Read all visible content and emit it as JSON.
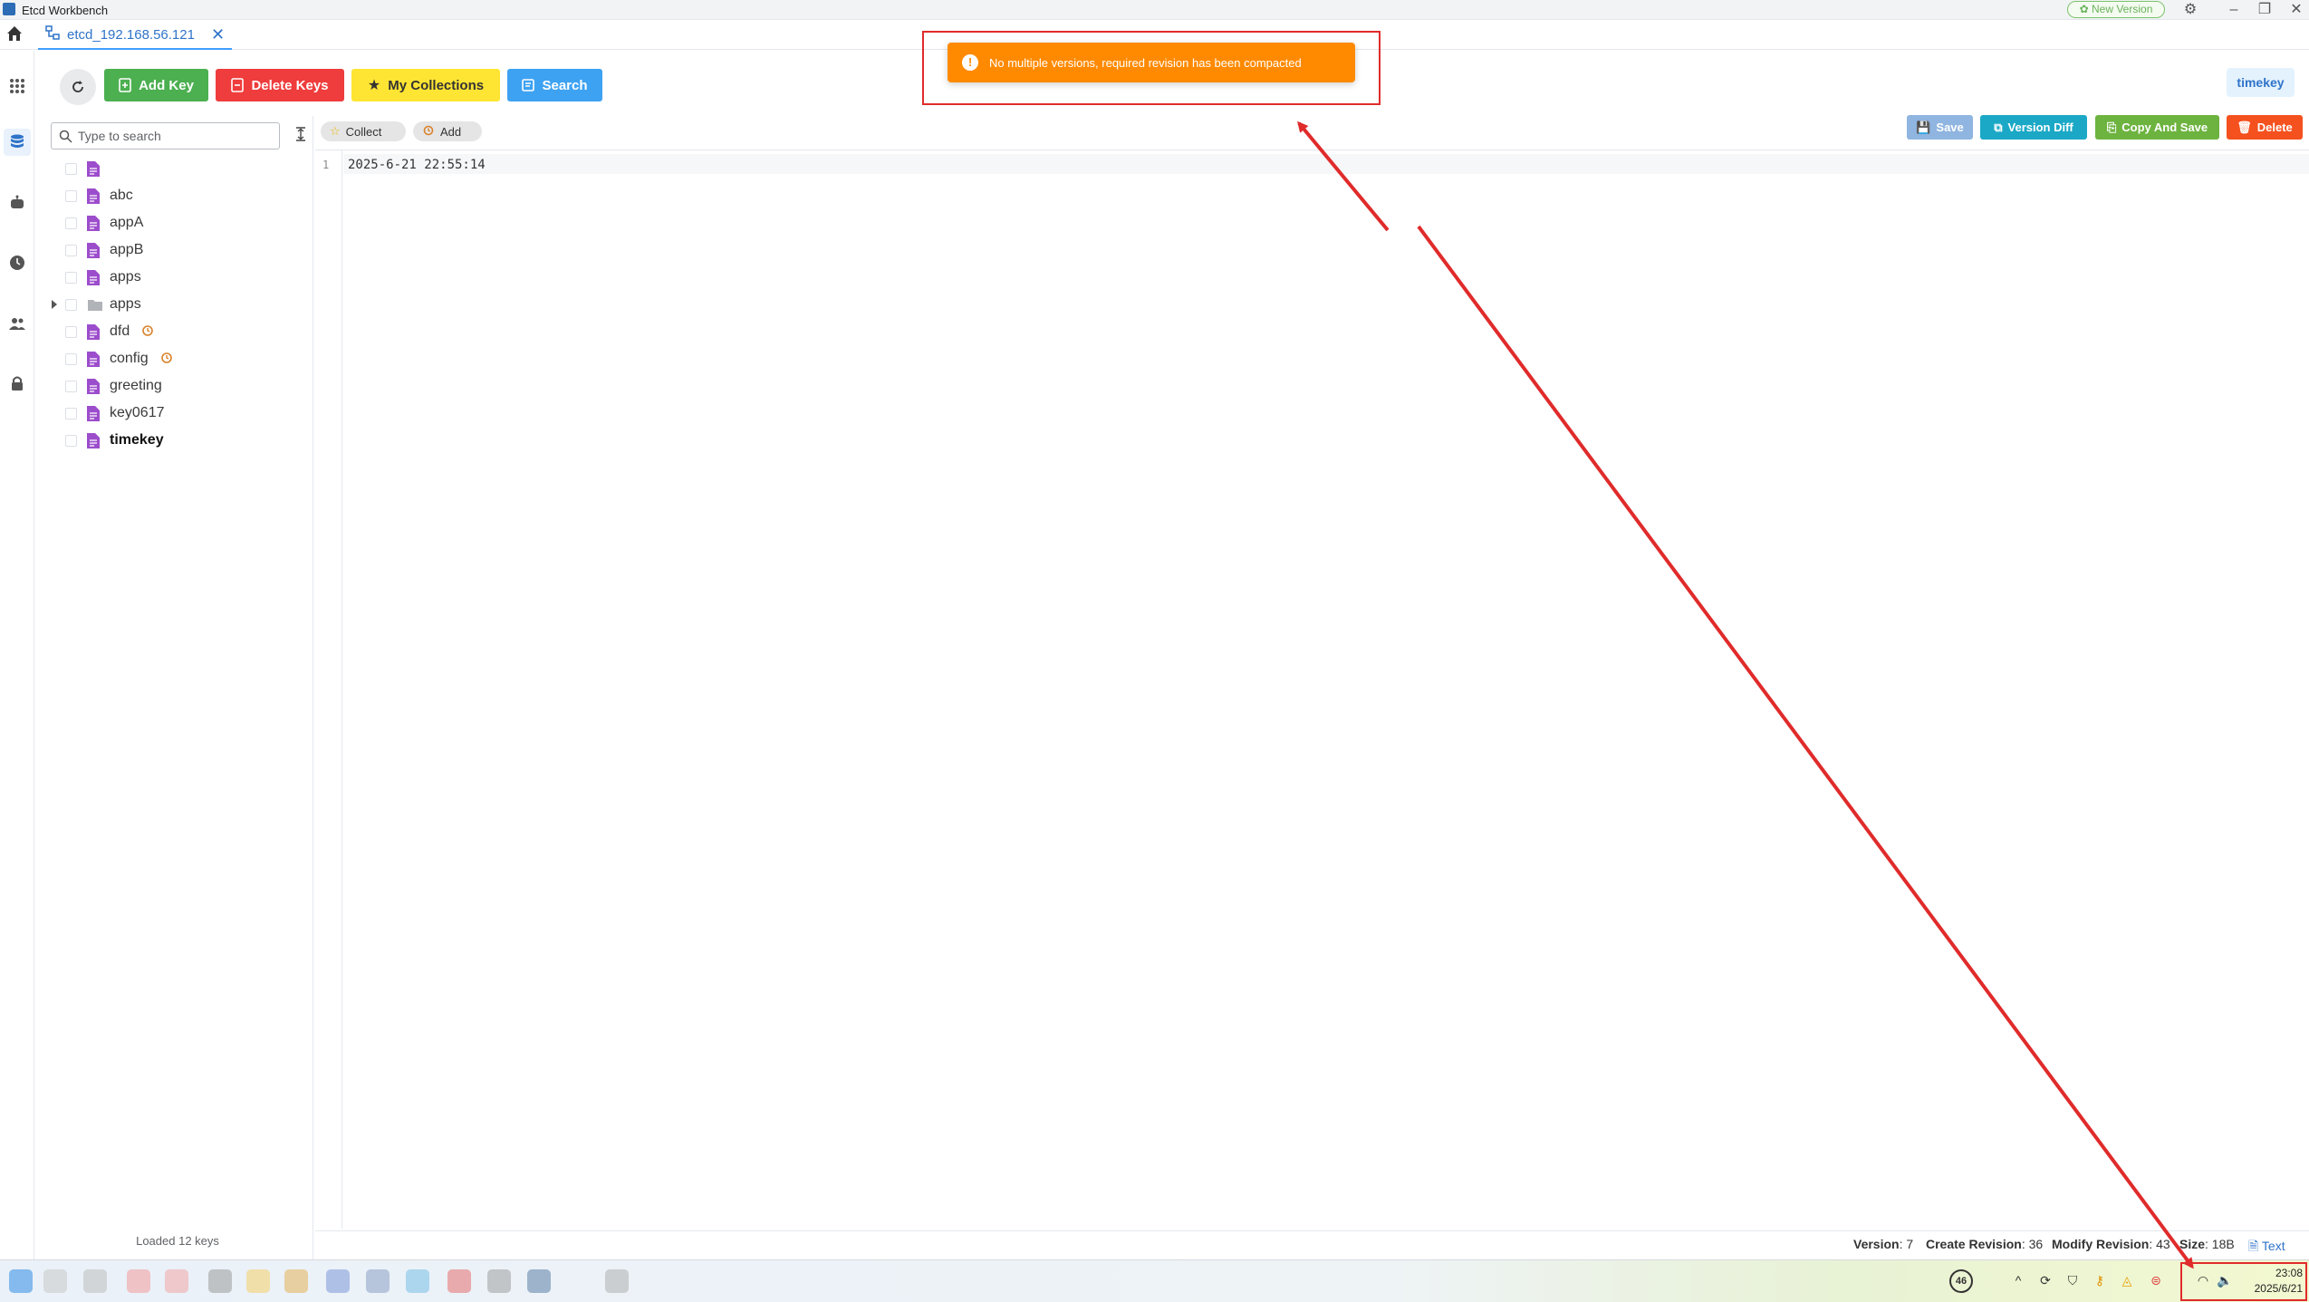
{
  "window": {
    "title": "Etcd Workbench",
    "new_version_label": "New Version",
    "controls": [
      "settings-icon",
      "minimize-icon",
      "restore-icon",
      "close-icon"
    ]
  },
  "tabs": {
    "connection_label": "etcd_192.168.56.121"
  },
  "rail": {
    "items": [
      "apps-grid-icon",
      "database-icon",
      "robot-icon",
      "clock-icon",
      "users-icon",
      "lock-icon"
    ],
    "active": "database-icon"
  },
  "toolbar": {
    "add_key": "Add Key",
    "delete_keys": "Delete Keys",
    "my_collections": "My Collections",
    "search": "Search"
  },
  "notification": {
    "message": "No multiple versions, required revision has been compacted",
    "type": "warning",
    "color": "#ff8a00"
  },
  "current_key_badge": "timekey",
  "sidebar": {
    "search_placeholder": "Type to search",
    "keys": [
      {
        "label": "",
        "type": "file",
        "lease": false
      },
      {
        "label": "abc",
        "type": "file",
        "lease": false
      },
      {
        "label": "appA",
        "type": "file",
        "lease": false
      },
      {
        "label": "appB",
        "type": "file",
        "lease": false
      },
      {
        "label": "apps",
        "type": "file",
        "lease": false
      },
      {
        "label": "apps",
        "type": "folder",
        "lease": false
      },
      {
        "label": "dfd",
        "type": "file",
        "lease": true
      },
      {
        "label": "config",
        "type": "file",
        "lease": true
      },
      {
        "label": "greeting",
        "type": "file",
        "lease": false
      },
      {
        "label": "key0617",
        "type": "file",
        "lease": false
      },
      {
        "label": "timekey",
        "type": "file",
        "lease": false,
        "selected": true
      }
    ],
    "loaded_text": "Loaded 12 keys"
  },
  "editor": {
    "collect_label": "Collect",
    "add_label": "Add",
    "save_label": "Save",
    "version_diff_label": "Version Diff",
    "copy_and_save_label": "Copy And Save",
    "delete_label": "Delete",
    "line_number": "1",
    "content": "2025-6-21 22:55:14"
  },
  "status": {
    "version_label": "Version",
    "version_value": ": 7",
    "create_label": "Create Revision",
    "create_value": ": 36",
    "modify_label": "Modify Revision",
    "modify_value": ": 43",
    "size_label": "Size",
    "size_value": ": 18B",
    "format": "Text"
  },
  "taskbar": {
    "badge_count": "46",
    "time": "23:08",
    "date": "2025/6/21"
  },
  "colors": {
    "accent": "#409eff",
    "add_key": "#4caf50",
    "delete_keys": "#ef3c3c",
    "my_collections": "#ffe533",
    "search": "#3ea2f2",
    "file_icon": "#9c4dcc",
    "annotation_red": "#e02b2b"
  }
}
